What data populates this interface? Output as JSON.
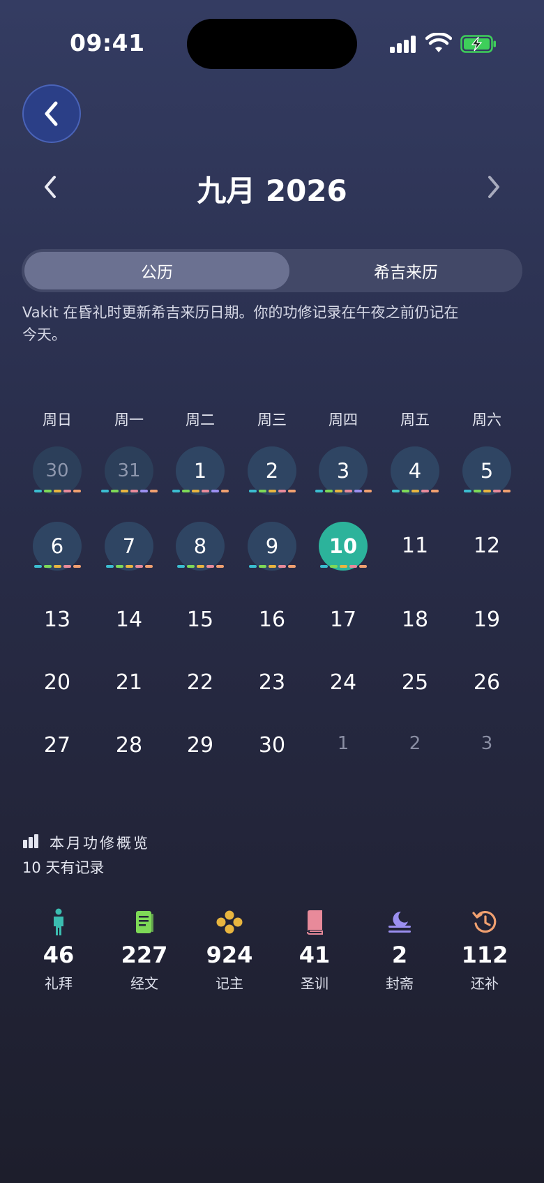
{
  "status": {
    "time": "09:41"
  },
  "header": {
    "month_title": "九月 2026"
  },
  "tabs": [
    {
      "label": "公历",
      "active": true
    },
    {
      "label": "希吉来历",
      "active": false
    }
  ],
  "note": "Vakit 在昏礼时更新希吉来历日期。你的功修记录在午夜之前仍记在今天。",
  "weekdays": [
    "周日",
    "周一",
    "周二",
    "周三",
    "周四",
    "周五",
    "周六"
  ],
  "colors": {
    "accent_today": "#2cb39b",
    "dash": [
      "#3bbdd0",
      "#7ed957",
      "#e8b53f",
      "#e88a9a",
      "#9b8ff0",
      "#f0a070"
    ]
  },
  "calendar": {
    "rows": [
      [
        {
          "d": "30",
          "state": "recorded-other"
        },
        {
          "d": "31",
          "state": "recorded-other"
        },
        {
          "d": "1",
          "state": "recorded"
        },
        {
          "d": "2",
          "state": "recorded"
        },
        {
          "d": "3",
          "state": "recorded"
        },
        {
          "d": "4",
          "state": "recorded"
        },
        {
          "d": "5",
          "state": "recorded"
        }
      ],
      [
        {
          "d": "6",
          "state": "recorded"
        },
        {
          "d": "7",
          "state": "recorded"
        },
        {
          "d": "8",
          "state": "recorded"
        },
        {
          "d": "9",
          "state": "recorded"
        },
        {
          "d": "10",
          "state": "today"
        },
        {
          "d": "11",
          "state": "plain"
        },
        {
          "d": "12",
          "state": "plain"
        }
      ],
      [
        {
          "d": "13",
          "state": "plain"
        },
        {
          "d": "14",
          "state": "plain"
        },
        {
          "d": "15",
          "state": "plain"
        },
        {
          "d": "16",
          "state": "plain"
        },
        {
          "d": "17",
          "state": "plain"
        },
        {
          "d": "18",
          "state": "plain"
        },
        {
          "d": "19",
          "state": "plain"
        }
      ],
      [
        {
          "d": "20",
          "state": "plain"
        },
        {
          "d": "21",
          "state": "plain"
        },
        {
          "d": "22",
          "state": "plain"
        },
        {
          "d": "23",
          "state": "plain"
        },
        {
          "d": "24",
          "state": "plain"
        },
        {
          "d": "25",
          "state": "plain"
        },
        {
          "d": "26",
          "state": "plain"
        }
      ],
      [
        {
          "d": "27",
          "state": "plain"
        },
        {
          "d": "28",
          "state": "plain"
        },
        {
          "d": "29",
          "state": "plain"
        },
        {
          "d": "30",
          "state": "plain"
        },
        {
          "d": "1",
          "state": "other"
        },
        {
          "d": "2",
          "state": "other"
        },
        {
          "d": "3",
          "state": "other"
        }
      ]
    ]
  },
  "overview": {
    "title": "本月功修概览",
    "subtitle": "10 天有记录",
    "stats": [
      {
        "icon": "person-standing-icon",
        "value": "46",
        "label": "礼拜",
        "color": "#3bbdb0"
      },
      {
        "icon": "book-page-icon",
        "value": "227",
        "label": "经文",
        "color": "#7ed957"
      },
      {
        "icon": "beads-icon",
        "value": "924",
        "label": "记主",
        "color": "#e8b53f"
      },
      {
        "icon": "book-icon",
        "value": "41",
        "label": "圣训",
        "color": "#e88a9a"
      },
      {
        "icon": "moon-icon",
        "value": "2",
        "label": "封斋",
        "color": "#9b8ff0"
      },
      {
        "icon": "history-icon",
        "value": "112",
        "label": "还补",
        "color": "#f0a070"
      }
    ]
  }
}
